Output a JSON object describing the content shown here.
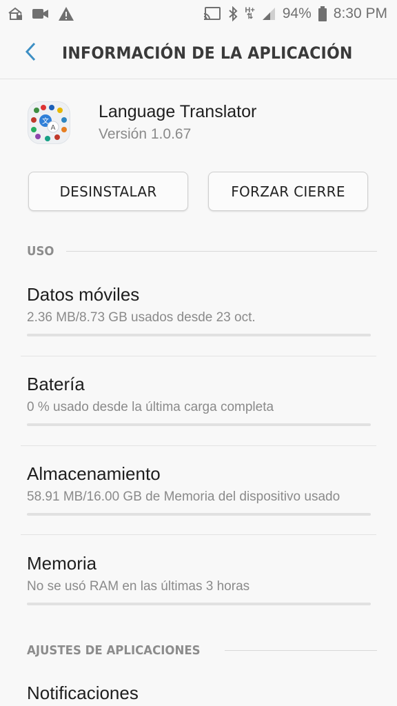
{
  "status_bar": {
    "battery": "94%",
    "time": "8:30 PM",
    "network_label": "H+",
    "left_icons": [
      "lock-screen-icon",
      "camera-icon",
      "warning-icon"
    ],
    "right_icons": [
      "cast-icon",
      "bluetooth-icon",
      "signal-icon",
      "battery-icon"
    ]
  },
  "header": {
    "title": "INFORMACIÓN DE LA APLICACIÓN",
    "back_icon": "chevron-left-icon"
  },
  "app": {
    "name": "Language Translator",
    "version": "Versión 1.0.67"
  },
  "buttons": {
    "uninstall": "DESINSTALAR",
    "force_stop": "FORZAR CIERRE"
  },
  "sections": {
    "usage": "USO",
    "app_settings": "AJUSTES DE APLICACIONES"
  },
  "usage_items": [
    {
      "title": "Datos móviles",
      "subtitle": "2.36 MB/8.73 GB usados desde 23 oct.",
      "progress": 0
    },
    {
      "title": "Batería",
      "subtitle": "0 % usado desde la última carga completa",
      "progress": 0
    },
    {
      "title": "Almacenamiento",
      "subtitle": "58.91 MB/16.00 GB de Memoria del dispositivo usado",
      "progress": 0
    },
    {
      "title": "Memoria",
      "subtitle": "No se usó RAM en las últimas 3 horas",
      "progress": 0
    }
  ],
  "settings_items": [
    {
      "title": "Notificaciones"
    }
  ],
  "colors": {
    "accent": "#3d8fc4",
    "background": "#f8f8f8",
    "subtext": "#8a8a8a"
  }
}
